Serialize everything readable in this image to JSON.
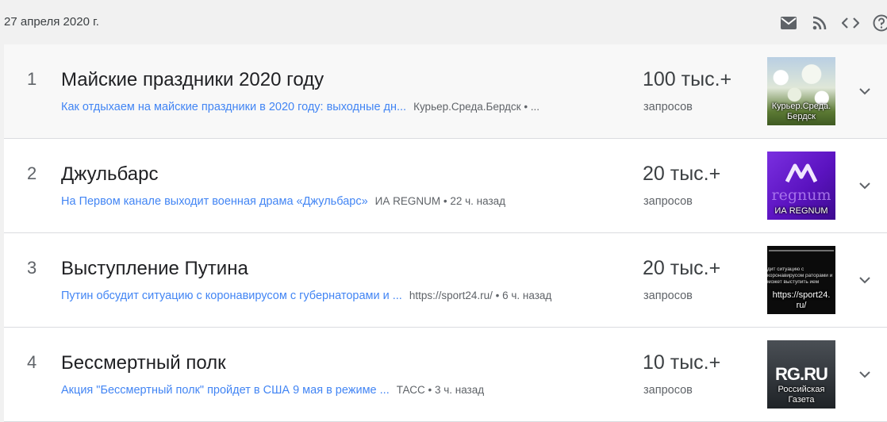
{
  "header": {
    "date": "27 апреля 2020 г.",
    "icons": [
      "email-icon",
      "rss-icon",
      "embed-code-icon",
      "help-icon"
    ]
  },
  "colors": {
    "link": "#4285f4",
    "text": "#202124",
    "secondary": "#5f6368",
    "background": "#f1f1f1"
  },
  "items": [
    {
      "rank": "1",
      "title": "Майские праздники 2020 году",
      "article": "Как отдыхаем на майские праздники в 2020 году: выходные дн...",
      "meta": "Курьер.Среда.Бердск • ...",
      "count": "100 тыс.+",
      "count_label": "запросов",
      "thumb_caption": "Курьер.Среда. Бердск"
    },
    {
      "rank": "2",
      "title": "Джульбарс",
      "article": "На Первом канале выходит военная драма «Джульбарс»",
      "meta": "ИА REGNUM • 22 ч. назад",
      "count": "20 тыс.+",
      "count_label": "запросов",
      "thumb_caption": "ИА REGNUM",
      "thumb_logo": "regnum"
    },
    {
      "rank": "3",
      "title": "Выступление Путина",
      "article": "Путин обсудит ситуацию с коронавирусом с губернаторами и ...",
      "meta": "https://sport24.ru/ • 6 ч. назад",
      "count": "20 тыс.+",
      "count_label": "запросов",
      "thumb_caption": "https://sport24. ru/",
      "thumb_text": "дит ситуацию с коронавирусом раторами и может выступить ием"
    },
    {
      "rank": "4",
      "title": "Бессмертный полк",
      "article": "Акция \"Бессмертный полк\" пройдет в США 9 мая в режиме ...",
      "meta": "ТАСС • 3 ч. назад",
      "count": "10 тыс.+",
      "count_label": "запросов",
      "thumb_caption": "Российская Газета",
      "thumb_logo": "RG.RU"
    }
  ]
}
